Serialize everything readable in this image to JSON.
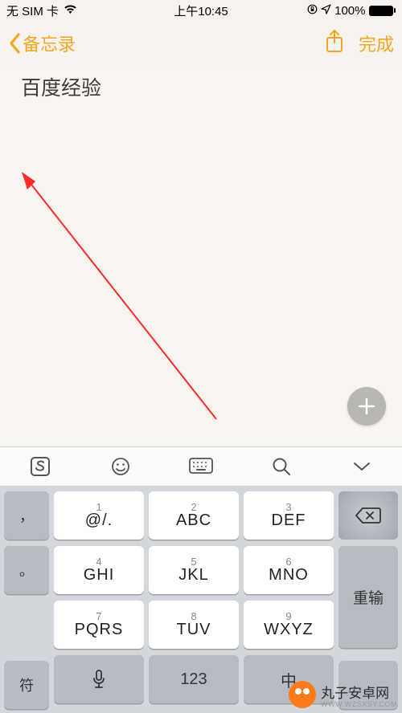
{
  "status": {
    "carrier": "无 SIM 卡",
    "time": "上午10:45",
    "battery_pct": "100%"
  },
  "nav": {
    "back_label": "备忘录",
    "done_label": "完成"
  },
  "note": {
    "content": "百度经验"
  },
  "toolbar": {
    "items": [
      "sogou-icon",
      "emoji-icon",
      "keyboard-icon",
      "search-icon",
      "collapse-icon"
    ]
  },
  "keyboard": {
    "side_top": "，",
    "side_mid": "。",
    "side_bottom": "符",
    "right_redo": "重输",
    "bottom_mic": "mic",
    "bottom_123": "123",
    "bottom_lang": "中",
    "keys": [
      [
        {
          "num": "1",
          "label": "@/."
        },
        {
          "num": "2",
          "label": "ABC"
        },
        {
          "num": "3",
          "label": "DEF"
        }
      ],
      [
        {
          "num": "4",
          "label": "GHI"
        },
        {
          "num": "5",
          "label": "JKL"
        },
        {
          "num": "6",
          "label": "MNO"
        }
      ],
      [
        {
          "num": "7",
          "label": "PQRS"
        },
        {
          "num": "8",
          "label": "TUV"
        },
        {
          "num": "9",
          "label": "WXYZ"
        }
      ]
    ]
  },
  "watermark": {
    "text": "丸子安卓网",
    "url": "WWW.WZSXSY.COM"
  }
}
